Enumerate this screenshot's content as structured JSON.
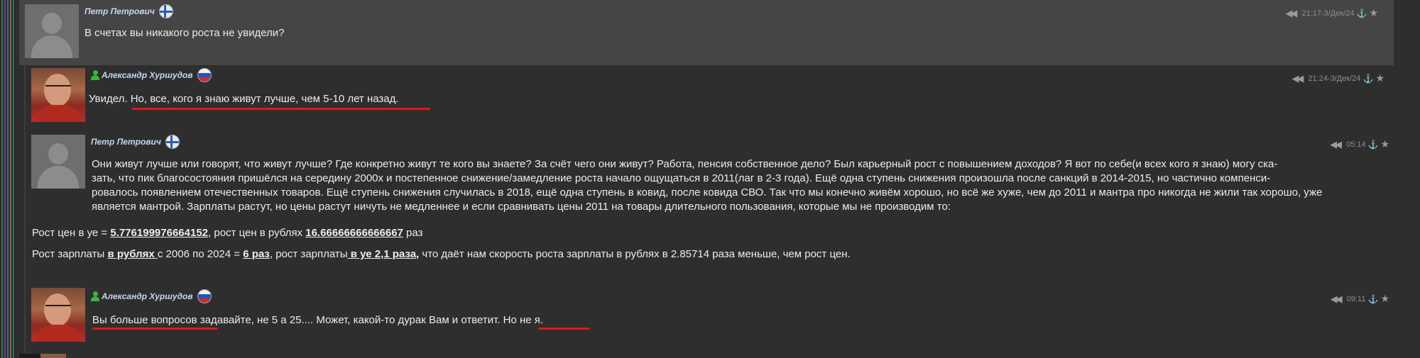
{
  "ui": {
    "accent_link": "#c7d4f6",
    "highlight": "#e01818",
    "online": "#3fb43a"
  },
  "posts": [
    {
      "author": "Петр Петрович",
      "flag": "finland-flag-icon",
      "time": "21:17-3/Дек/24",
      "text": "В счетах вы никакого роста не увидели?"
    },
    {
      "author": "Александр Хуршудов",
      "flag": "russia-flag-icon",
      "time": "21:24-3/Дек/24",
      "text_a": "Увидел. ",
      "text_b": "Но, все, кого я знаю живут лучше, чем 5-10 лет назад."
    },
    {
      "author": "Петр Петрович",
      "flag": "finland-flag-icon",
      "time": "05:14",
      "lines": [
        "Они живут лучше или говорят, что живут лучше? Где конкретно живут те кого вы знаете? За счёт чего они живут? Работа, пенсия собственное дело? Был карьерный рост с повышением доходов? Я вот по себе(и всех кого я знаю) могу ска-",
        "зать, что пик благосостояния пришёлся на середину 2000х и постепенное снижение/замедление роста начало ощущаться в 2011(лаг в 2-3 года). Ещё одна ступень снижения произошла после санкций в 2014-2015, но частично компенси-",
        "ровалось появлением отечественных товаров. Ещё ступень снижения случилась в 2018, ещё одна ступень в ковид, после ковида СВО. Так что мы конечно живём хорошо, но всё же хуже, чем до 2011 и мантра про никогда не жили так хорошо, уже",
        "является мантрой. Зарплаты растут, но цены растут ничуть не медленнее и если сравнивать цены 2011 на товары длительного пользования, которые мы не производим то:"
      ],
      "price_line": {
        "p1": "Рост цен в уе = ",
        "v1": "5.776199976664152",
        "p2": ", рост цен в рублях ",
        "v2": "16.66666666666667",
        "p3": " раз"
      },
      "salary_line": {
        "p1": "Рост зарплаты ",
        "v1": "в рублях ",
        "p2": "с 2006 по 2024 = ",
        "v2": "6 раз",
        "p3": ", рост зарплаты",
        "v3": " в уе 2,1 раза,",
        "p4": " что даёт нам скорость роста зарплаты в рублях в 2.85714 раза меньше, чем рост цен."
      }
    },
    {
      "author": "Александр Хуршудов",
      "flag": "russia-flag-icon",
      "time": "09:11",
      "text_a": "Вы больше вопросов",
      "text_b": " задавайте, не 5 а 25.... Может, какой-то дурак Вам и ответит. ",
      "text_c": "Но не я."
    }
  ],
  "icons": {
    "reply": "◀◀",
    "anchor": "⚓",
    "star": "★"
  }
}
